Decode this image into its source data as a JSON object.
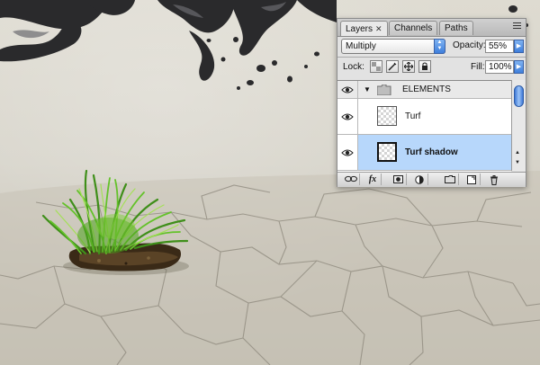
{
  "panel": {
    "tabs": [
      {
        "label": "Layers",
        "close": "✕",
        "active": true
      },
      {
        "label": "Channels",
        "active": false
      },
      {
        "label": "Paths",
        "active": false
      }
    ],
    "blend_mode": "Multiply",
    "opacity_label": "Opacity:",
    "opacity_value": "55%",
    "lock_label": "Lock:",
    "fill_label": "Fill:",
    "fill_value": "100%",
    "layers": [
      {
        "name": "ELEMENTS",
        "type": "group",
        "visible": true,
        "expanded": true
      },
      {
        "name": "Turf",
        "type": "layer",
        "visible": true,
        "selected": false
      },
      {
        "name": "Turf shadow",
        "type": "layer",
        "visible": true,
        "selected": true
      }
    ],
    "bottom_buttons": [
      "link-icon",
      "fx-icon",
      "mask-icon",
      "adjustment-icon",
      "new-group-icon",
      "new-layer-icon",
      "trash-icon"
    ],
    "fx_label": "fx",
    "selection_color": "#b7d7fb"
  }
}
